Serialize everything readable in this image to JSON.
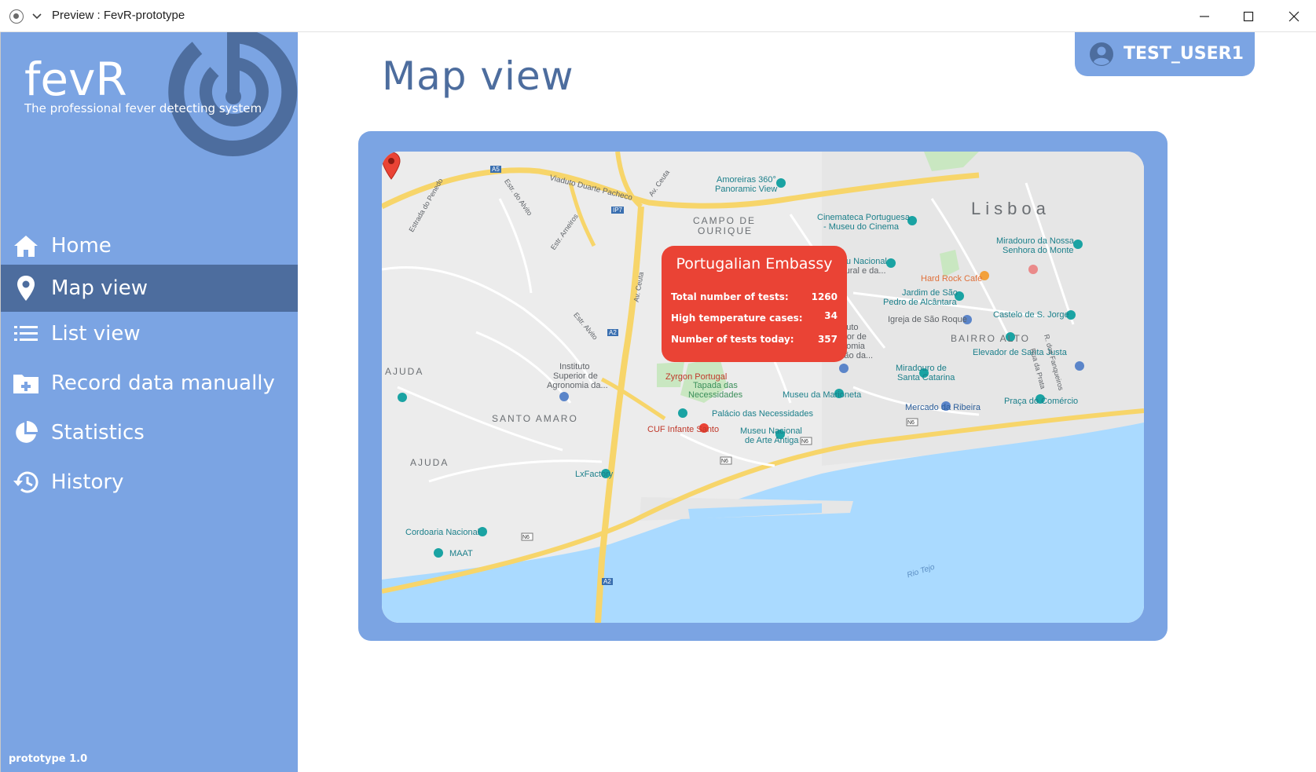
{
  "window": {
    "title": "Preview : FevR-prototype"
  },
  "brand": {
    "name": "fevR",
    "tagline": "The professional fever detecting system"
  },
  "nav": {
    "items": [
      {
        "label": "Home",
        "icon": "home-icon",
        "active": false
      },
      {
        "label": "Map view",
        "icon": "map-pin-icon",
        "active": true
      },
      {
        "label": "List view",
        "icon": "list-icon",
        "active": false
      },
      {
        "label": "Record data manually",
        "icon": "folder-plus-icon",
        "active": false
      },
      {
        "label": "Statistics",
        "icon": "pie-chart-icon",
        "active": false
      },
      {
        "label": "History",
        "icon": "history-icon",
        "active": false
      }
    ]
  },
  "version": "prototype 1.0",
  "user": {
    "name": "TEST_USER1"
  },
  "page": {
    "title": "Map view"
  },
  "map": {
    "popup": {
      "title": "Portugalian Embassy",
      "rows": [
        {
          "label": "Total number of tests:",
          "value": "1260"
        },
        {
          "label": "High temperature cases:",
          "value": "34"
        },
        {
          "label": "Number of tests today:",
          "value": "357"
        }
      ]
    },
    "marker_label": "Zyrgon Portugal",
    "labels": {
      "amoreiras": "Amoreiras 360°",
      "amoreiras2": "Panoramic View",
      "viaduto": "Viaduto Duarte Pacheco",
      "campo1": "CAMPO DE",
      "campo2": "OURIQUE",
      "cinemateca1": "Cinemateca Portuguesa",
      "cinemateca2": "- Museu do Cinema",
      "lisboa": "Lisboa",
      "miradouro_nossa1": "Miradouro da Nossa",
      "miradouro_nossa2": "Senhora do Monte",
      "museu_nac1": "Museu Nacional",
      "museu_nac2": "tória Natural e da...",
      "hardrock": "Hard Rock Cafe",
      "jardim1": "Jardim de São",
      "jardim2": "Pedro de Alcântara",
      "igreja": "Igreja de São Roque",
      "castelo": "Castelo de S. Jorge",
      "instituto_eco1": "Instituto",
      "instituto_eco2": "Superior de",
      "instituto_eco3": "Economia",
      "instituto_eco4": "e Gestão da...",
      "bairro": "BAIRRO ALTO",
      "elevador": "Elevador de Santa Justa",
      "ajuda1": "AJUDA",
      "instituto_agro1": "Instituto",
      "instituto_agro2": "Superior de",
      "instituto_agro3": "Agronomia da...",
      "tapada1": "Tapada das",
      "tapada2": "Necessidades",
      "marioneta": "Museu da Marioneta",
      "miradouro_sc1": "Miradouro de",
      "miradouro_sc2": "Santa Catarina",
      "santo_amaro": "SANTO AMARO",
      "palacio": "Palácio das Necessidades",
      "mercado": "Mercado da Ribeira",
      "praca": "Praça do Comércio",
      "cuf": "CUF Infante Santo",
      "arte1": "Museu Nacional",
      "arte2": "de Arte Antiga",
      "ajuda2": "AJUDA",
      "lxfactory": "LxFactory",
      "cordoaria": "Cordoaria Nacional",
      "maat": "MAAT",
      "rio": "Rio Tejo",
      "estr_penedo": "Estrada do Penedo",
      "estr_alvito": "Estr. do Alvito",
      "estr_alvito2": "Estr. Alvito",
      "estr_arneiros": "Estr. Arneiros",
      "av_ceuta": "Av. Ceuta",
      "av_ceuta2": "Av. Ceuta",
      "r_fanqueiros": "R. dos Fanqueiros",
      "r_prata": "Rua da Prata"
    }
  }
}
